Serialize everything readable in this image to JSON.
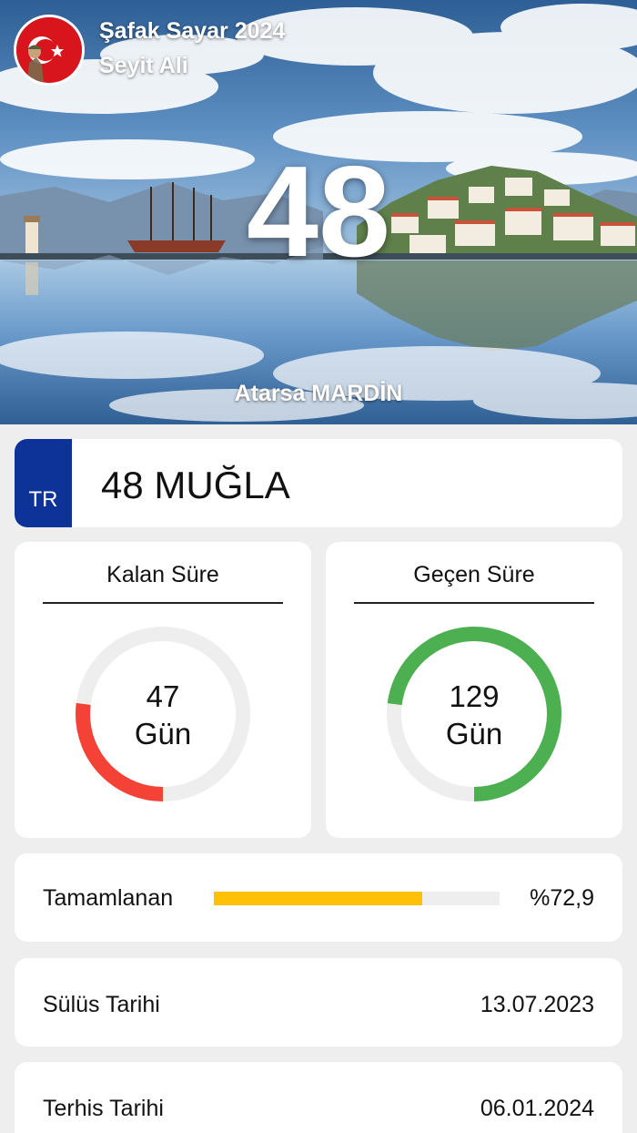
{
  "header": {
    "app_title": "Şafak Sayar 2024",
    "user_name": "Seyit Ali",
    "remaining_big": "48",
    "location": "Atarsa MARDİN"
  },
  "plate": {
    "country_code": "TR",
    "text": "48 MUĞLA",
    "strip_color": "#0d3399"
  },
  "remaining": {
    "label": "Kalan Süre",
    "days": "47",
    "unit": "Gün",
    "fraction": 0.27,
    "color": "#f44336"
  },
  "elapsed": {
    "label": "Geçen Süre",
    "days": "129",
    "unit": "Gün",
    "fraction": 0.73,
    "color": "#4caf50"
  },
  "progress": {
    "label": "Tamamlanan",
    "value_text": "%72,9",
    "fraction": 0.729,
    "color": "#ffc107"
  },
  "dates": {
    "induction_label": "Sülüs Tarihi",
    "induction_value": "13.07.2023",
    "discharge_label": "Terhis Tarihi",
    "discharge_value": "06.01.2024"
  },
  "icons": {
    "avatar": "soldier-flag-avatar-icon"
  }
}
